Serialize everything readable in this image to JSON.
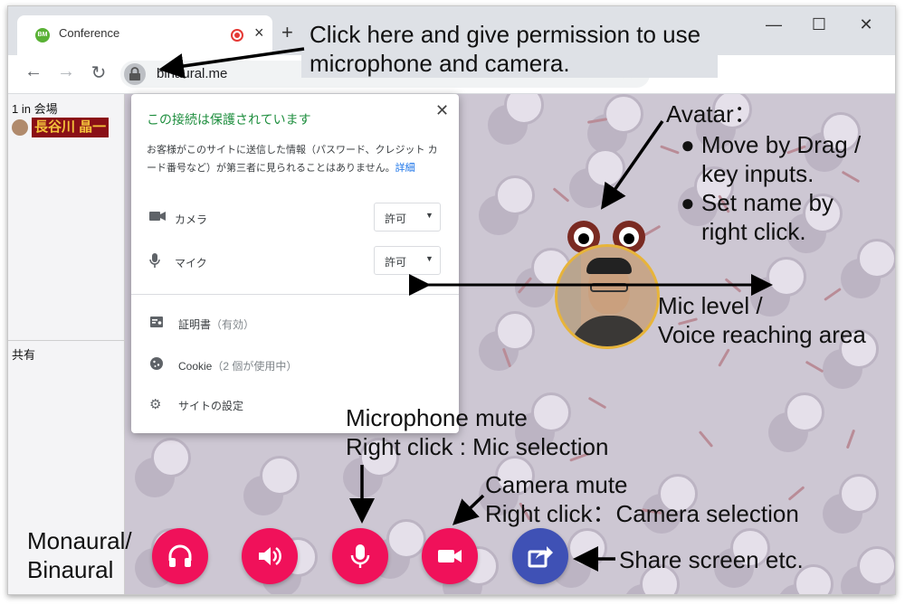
{
  "browser": {
    "tab_title": "Conference",
    "tab_favicon_text": "BM",
    "url": "binaural.me"
  },
  "left_panel": {
    "count_label": "1 in 会場",
    "user_name": "長谷川 晶一",
    "share_label": "共有"
  },
  "site_info_popup": {
    "title": "この接続は保護されています",
    "description": "お客様がこのサイトに送信した情報（パスワード、クレジット カード番号など）が第三者に見られることはありません。",
    "details_link": "詳細",
    "permissions": [
      {
        "icon": "videocam-icon",
        "label": "カメラ",
        "value": "許可"
      },
      {
        "icon": "mic-icon",
        "label": "マイク",
        "value": "許可"
      }
    ],
    "certificate": {
      "label": "証明書",
      "sub": "（有効）"
    },
    "cookie": {
      "label": "Cookie",
      "sub": "（2 個が使用中）"
    },
    "site_settings": "サイトの設定"
  },
  "controls": [
    {
      "name": "headphones-button",
      "icon": "headphones-icon",
      "color": "#f0115a"
    },
    {
      "name": "speaker-button",
      "icon": "volume-icon",
      "color": "#f0115a"
    },
    {
      "name": "mic-mute-button",
      "icon": "mic-icon",
      "color": "#f0115a"
    },
    {
      "name": "camera-mute-button",
      "icon": "videocam-icon",
      "color": "#f0115a"
    },
    {
      "name": "share-screen-button",
      "icon": "share-icon",
      "color": "#3f51b5"
    }
  ],
  "annotations": {
    "permission_line1": "Click here and give permission to use",
    "permission_line2": "microphone and camera.",
    "avatar_title": "Avatar：",
    "avatar_b1_line1": "● Move by Drag /",
    "avatar_b1_line2": "key inputs.",
    "avatar_b2_line1": "● Set name by",
    "avatar_b2_line2": "right click.",
    "mic_level_line1": "Mic level /",
    "mic_level_line2": "Voice reaching area",
    "mic_mute_line1": "Microphone mute",
    "mic_mute_line2": "Right click : Mic selection",
    "camera_mute_line1": "Camera mute",
    "camera_mute_line2": "Right click：Camera selection",
    "monaural_line1": "Monaural/",
    "monaural_line2": "Binaural",
    "share_screen": "Share screen etc."
  }
}
